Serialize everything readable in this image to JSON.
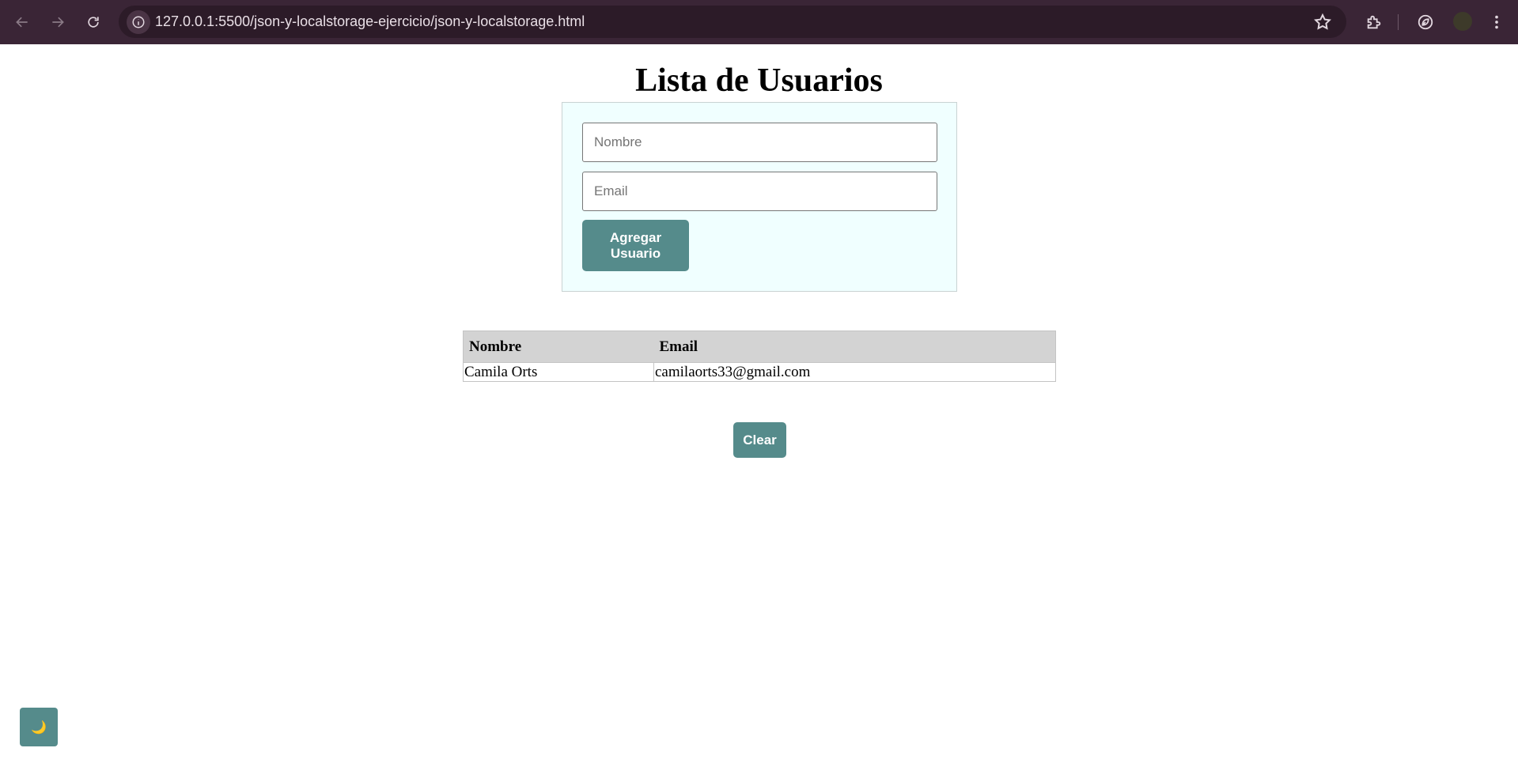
{
  "browser": {
    "url": "127.0.0.1:5500/json-y-localstorage-ejercicio/json-y-localstorage.html",
    "icons": {
      "back": "arrow-left-icon",
      "forward": "arrow-right-icon",
      "reload": "reload-icon",
      "site_info": "info-icon",
      "bookmark": "star-icon",
      "extensions": "puzzle-icon",
      "performance": "leaf-icon",
      "menu": "kebab-menu-icon"
    }
  },
  "page": {
    "title": "Lista de Usuarios",
    "form": {
      "nombre_placeholder": "Nombre",
      "email_placeholder": "Email",
      "add_button_label": "Agregar Usuario"
    },
    "table": {
      "headers": [
        "Nombre",
        "Email"
      ],
      "rows": [
        {
          "nombre": "Camila Orts",
          "email": "camilaorts33@gmail.com"
        }
      ]
    },
    "clear_button_label": "Clear",
    "theme_toggle_icon": "🌙"
  },
  "colors": {
    "chrome_bg": "#3a2536",
    "omnibox_bg": "#2c1b28",
    "card_bg": "#f0ffff",
    "button_bg": "#558b8b",
    "table_header_bg": "#d3d3d3"
  }
}
